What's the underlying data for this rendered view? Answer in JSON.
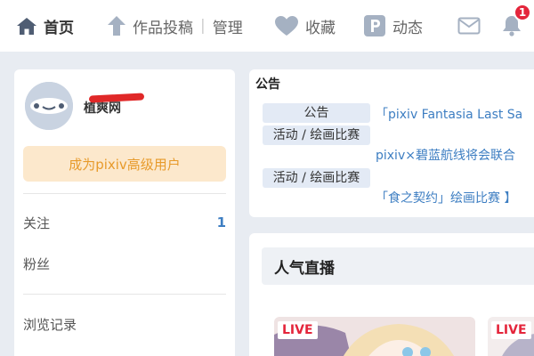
{
  "nav": {
    "home_label": "首页",
    "submit_label": "作品投稿",
    "manage_label": "管理",
    "favorites_label": "收藏",
    "activity_label": "动态",
    "notification_count": "1",
    "icons": [
      "home-icon",
      "upload-arrow-icon",
      "heart-icon",
      "pixiv-p-icon",
      "mail-icon",
      "bell-icon"
    ]
  },
  "profile": {
    "username": "植爽网",
    "premium_label": "成为pixiv高级用户",
    "following_label": "关注",
    "following_count": "1",
    "followers_label": "粉丝",
    "history_label": "浏览记录"
  },
  "notice": {
    "title": "公告",
    "items": [
      {
        "tag": "公告",
        "text": "「pixiv Fantasia Last Sa"
      },
      {
        "tag": "活动 / 绘画比赛",
        "text": "pixiv×碧蓝航线将会联合"
      },
      {
        "tag": "活动 / 绘画比赛",
        "text": "「食之契约」绘画比赛 】"
      }
    ]
  },
  "live": {
    "title": "人气直播",
    "badge": "LIVE"
  },
  "colors": {
    "accent_blue": "#3d7ec2",
    "premium_bg": "#fce8cc",
    "premium_text": "#e79a2a",
    "badge_red": "#e4253b",
    "page_bg": "#e8ecf2"
  }
}
